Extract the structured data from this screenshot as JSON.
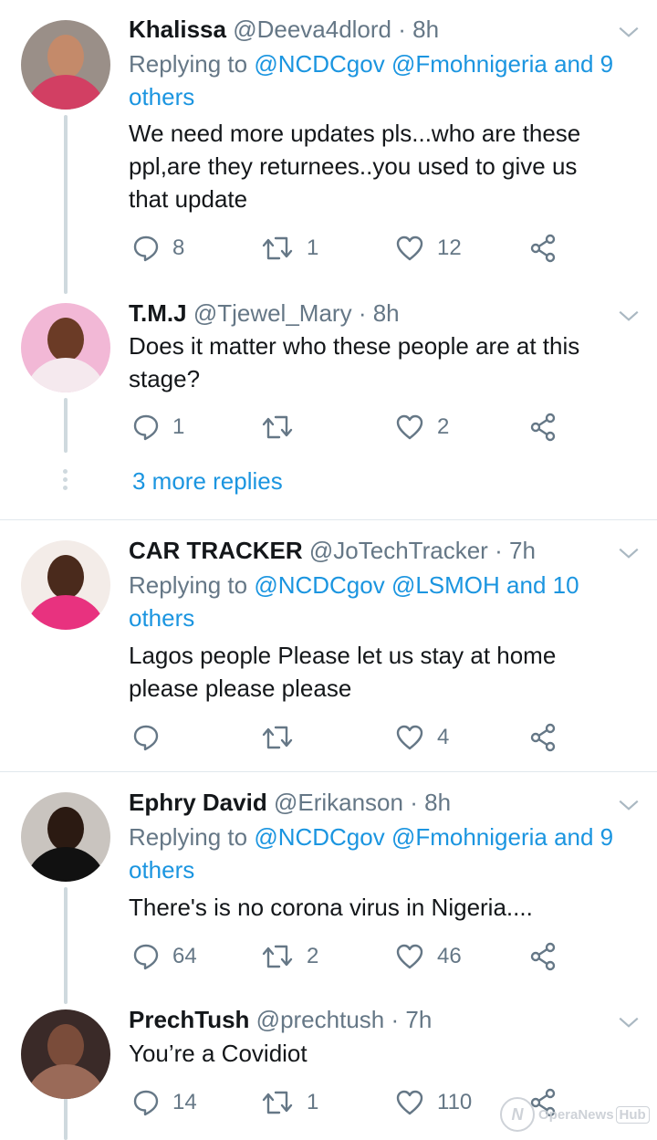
{
  "tweets": [
    {
      "name": "Khalissa",
      "handle": "@Deeva4dlord",
      "time": "8h",
      "replying_prefix": "Replying to",
      "replying_mentions": "@NCDCgov @Fmohnigeria and 9",
      "replying_others": "others",
      "text_lines": [
        "We need more updates pls...who are these",
        "ppl,are they returnees..you used to give us",
        "that update"
      ],
      "replies": "8",
      "retweets": "1",
      "likes": "12"
    },
    {
      "name": "T.M.J",
      "handle": "@Tjewel_Mary",
      "time": "8h",
      "text_lines": [
        "Does it matter who these people are at this",
        "stage?"
      ],
      "replies": "1",
      "retweets": "",
      "likes": "2",
      "more_replies": "3 more replies"
    },
    {
      "name": "CAR TRACKER",
      "handle": "@JoTechTracker",
      "time": "7h",
      "replying_prefix": "Replying to",
      "replying_mentions": "@NCDCgov @LSMOH and 10",
      "replying_others": "others",
      "text_lines": [
        "Lagos people Please let us stay at home",
        "please please please"
      ],
      "replies": "",
      "retweets": "",
      "likes": "4"
    },
    {
      "name": "Ephry David",
      "handle": "@Erikanson",
      "time": "8h",
      "replying_prefix": "Replying to",
      "replying_mentions": "@NCDCgov @Fmohnigeria and 9",
      "replying_others": "others",
      "text_lines": [
        "There's is no corona virus in Nigeria...."
      ],
      "replies": "64",
      "retweets": "2",
      "likes": "46"
    },
    {
      "name": "PrechTush",
      "handle": "@prechtush",
      "time": "7h",
      "text_lines": [
        "You’re a Covidiot"
      ],
      "replies": "14",
      "retweets": "1",
      "likes": "110"
    }
  ],
  "watermark": {
    "brand": "OperaNews",
    "suffix": "Hub"
  },
  "icons": {
    "reply": "reply-icon",
    "retweet": "retweet-icon",
    "like": "heart-icon",
    "share": "share-icon",
    "menu": "chevron-down-icon"
  },
  "colors": {
    "mention": "#1b95e0",
    "secondary_text": "#657786",
    "divider": "#e1e8ed",
    "thread_line": "#cfd9de"
  }
}
